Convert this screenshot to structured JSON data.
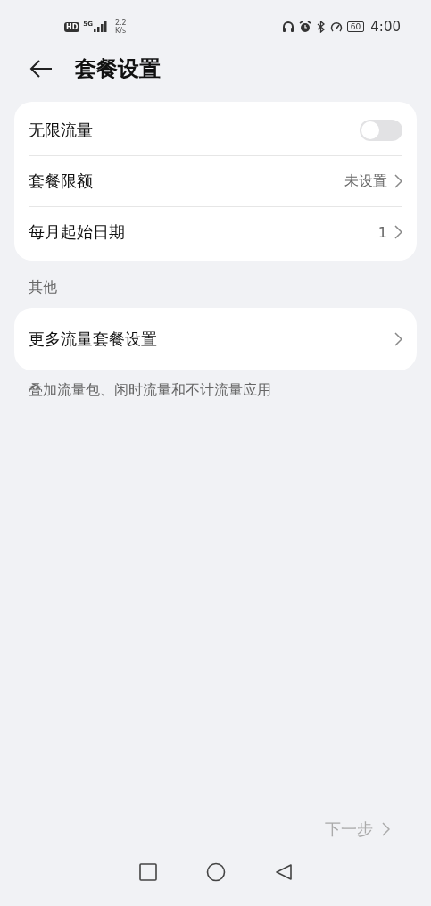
{
  "status_bar": {
    "hd": "HD",
    "network": "5G",
    "speed_value": "2.2",
    "speed_unit": "K/s",
    "battery": "60",
    "time": "4:00"
  },
  "header": {
    "title": "套餐设置"
  },
  "settings": [
    {
      "kind": "toggle",
      "label": "无限流量",
      "on": false
    },
    {
      "kind": "value",
      "label": "套餐限额",
      "value": "未设置"
    },
    {
      "kind": "value",
      "label": "每月起始日期",
      "value": "1"
    }
  ],
  "other_section": {
    "heading": "其他",
    "items": [
      {
        "label": "更多流量套餐设置"
      }
    ],
    "description": "叠加流量包、闲时流量和不计流量应用"
  },
  "next_button": {
    "label": "下一步",
    "disabled": true
  }
}
